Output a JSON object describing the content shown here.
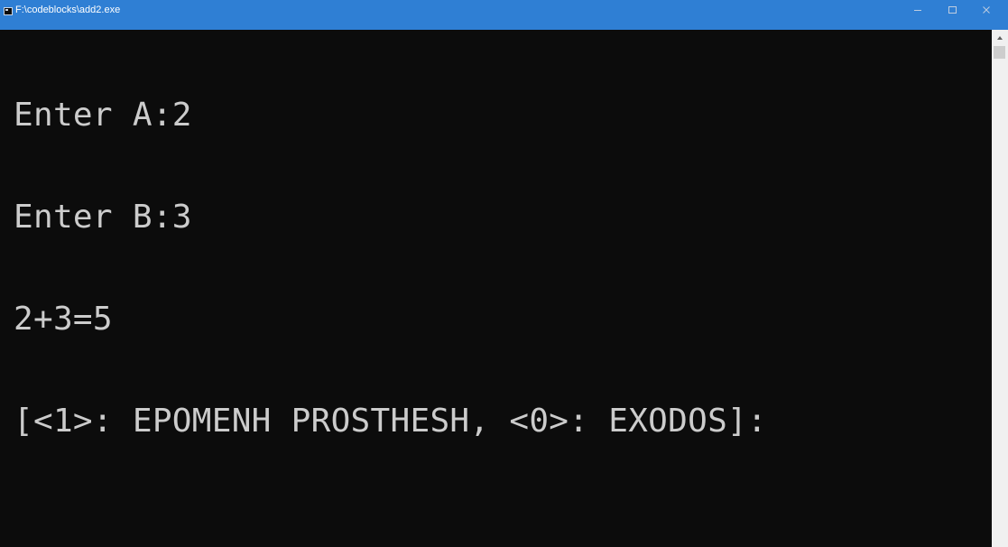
{
  "window": {
    "title": "F:\\codeblocks\\add2.exe",
    "controls": {
      "minimize_icon": "minimize-icon",
      "maximize_icon": "maximize-icon",
      "close_icon": "close-icon"
    }
  },
  "console": {
    "lines": [
      "Enter A:2",
      "Enter B:3",
      "2+3=5",
      "[<1>: EPOMENH PROSTHESH, <0>: EXODOS]:"
    ]
  },
  "colors": {
    "titlebar": "#2f7fd4",
    "background": "#0c0c0c",
    "text": "#cccccc"
  }
}
